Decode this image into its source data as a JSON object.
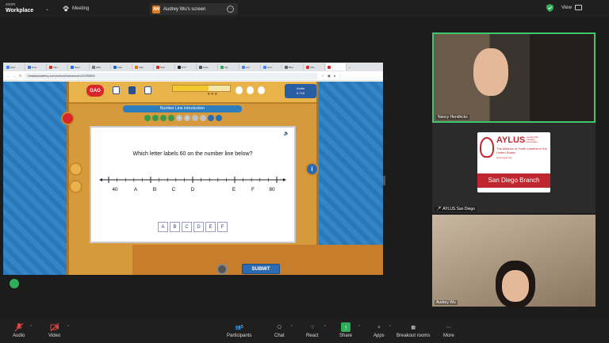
{
  "app": {
    "brand_small": "zoom",
    "brand_main": "Workplace"
  },
  "topbar": {
    "meeting_label": "Meeting",
    "share_pill": {
      "badge": "AW",
      "label": "Audrey Wu's screen"
    },
    "view_label": "View"
  },
  "browser": {
    "tabs": [
      "Sear",
      "New",
      "Inbo",
      "Spon",
      "SEU",
      "Clas",
      "Alas",
      "Spel",
      "NYT",
      "Asso",
      "trig",
      "unit",
      "seco",
      "Bloo",
      "Inbo",
      "",
      "+"
    ],
    "url": "beastacademy.com/school/classroom/2/2/805/5"
  },
  "game": {
    "logo": "GAO",
    "user_name": "Annie",
    "user_score": "5,716",
    "lesson_title": "Number Line Introduction",
    "progress_fraction": 0.62,
    "dots": [
      "",
      "",
      "",
      "",
      "5",
      "6",
      "",
      "",
      "",
      ""
    ],
    "question": "Which letter labels 60 on the number line below?",
    "number_line": {
      "labels": [
        "40",
        "A",
        "B",
        "C",
        "D",
        "",
        "E",
        "F",
        "80"
      ]
    },
    "answers": [
      "A",
      "B",
      "C",
      "D",
      "E",
      "F"
    ],
    "submit_label": "SUBMIT",
    "info_label": "i"
  },
  "participants": [
    {
      "name": "Nancy Hendricks",
      "muted": false
    },
    {
      "name": "AYLUS San Diego",
      "muted": true,
      "logo_title": "AYLUS",
      "logo_lines": [
        "Leadership",
        "Integrity",
        "Innovation"
      ],
      "logo_sub": "The Alliance of Youth Leaders in the United States",
      "logo_url": "www.aylus.org",
      "banner": "San Diego Branch"
    },
    {
      "name": "Audrey Wu",
      "muted": false
    }
  ],
  "toolbar": {
    "audio": "Audio",
    "video": "Video",
    "participants": "Participants",
    "participants_count": "5",
    "chat": "Chat",
    "react": "React",
    "share": "Share",
    "apps": "Apps",
    "breakout": "Breakout rooms",
    "more": "More"
  },
  "colors": {
    "accent_green": "#3ec66a",
    "mute_red": "#e24545",
    "share_green": "#2fae5a"
  }
}
